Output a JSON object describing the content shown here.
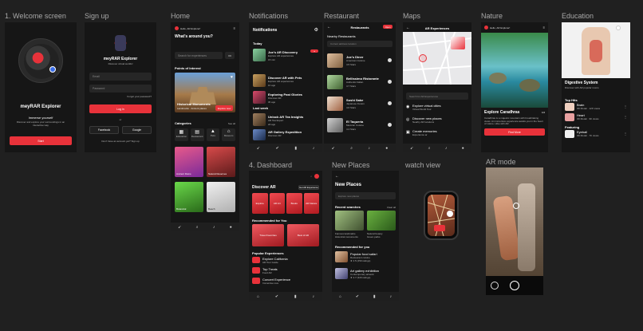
{
  "frames": {
    "welcome": "1. Welcome screen",
    "signup": "Sign up",
    "home": "Home",
    "notifications": "Notifications",
    "restaurant": "Restaurant",
    "maps": "Maps",
    "nature": "Nature",
    "education": "Education",
    "dashboard": "4. Dashboard",
    "new_places": "New Places",
    "watch": "watch view",
    "ar_mode": "AR mode"
  },
  "welcome": {
    "title": "meyRAR Explorer",
    "subtitle": "Immerse yourself",
    "desc": "Discover and explore your surroundings in an interactive way",
    "start": "Start"
  },
  "signup": {
    "title": "meyRAR Explorer",
    "subtitle": "Discover virtual worlds!",
    "email": "Email",
    "password": "Password",
    "forgot": "Forgot your password?",
    "login": "Log in",
    "or": "or",
    "facebook": "Facebook",
    "google": "Google",
    "no_account": "Don't have an account yet? Sign up"
  },
  "home": {
    "hello": "Hello, AR Explorer!",
    "question": "What's around you?",
    "search_placeholder": "Search for experiences",
    "poi": "Points of Interest",
    "poi_card": "Historical Monuments",
    "poi_sub": "Landmarks · Ancient places",
    "explore": "Explore now",
    "categories": "Categories",
    "see_all": "See all",
    "cat": [
      "Education",
      "Restaurant",
      "Pets",
      "Museum"
    ],
    "tiles": [
      "Ancient Ruins",
      "Natural Reserves",
      "Botanical",
      "Beach"
    ]
  },
  "notifications": {
    "title": "Notifications",
    "today": "Today",
    "last_week": "Last week",
    "items": [
      {
        "title": "Joe's AR Discovery",
        "sub": "Explore AR experiences",
        "meta": "15 min"
      },
      {
        "title": "Discover AR with Pets",
        "sub": "Explore AR experiences",
        "meta": "1h ago"
      },
      {
        "title": "Exploring Past Glories",
        "sub": "Discover AR",
        "meta": "3h ago"
      },
      {
        "title": "Unlock AR Tea Insights",
        "sub": "AR Tea Expert",
        "meta": "2d ago"
      },
      {
        "title": "AR Gallery Expedition",
        "sub": "Discover AR",
        "meta": "5d ago"
      }
    ]
  },
  "restaurant": {
    "title": "Restaurants",
    "badge": "Open",
    "nearby": "Nearby Restaurants",
    "address": "Current address location",
    "items": [
      {
        "name": "Joe's Diner",
        "cuisine": "American Cuisine",
        "rating": "4.5 Stars"
      },
      {
        "name": "Bellissimo Ristorante",
        "cuisine": "Authentic Italian",
        "rating": "4.7 Stars"
      },
      {
        "name": "Sushi Sake",
        "cuisine": "Japanese Fusion",
        "rating": "4.6 Stars"
      },
      {
        "name": "El Taqueria",
        "cuisine": "Mexican Cuisine",
        "rating": "4.4 Stars"
      }
    ]
  },
  "maps": {
    "title": "AR Experiences",
    "search_placeholder": "Search for AR Experiences",
    "items": [
      {
        "title": "Explore virtual cities",
        "sub": "Virtual World Tour"
      },
      {
        "title": "Discover new places",
        "sub": "Nearby AR locations"
      },
      {
        "title": "Create memories",
        "sub": "Experience ar"
      }
    ]
  },
  "nature": {
    "hello": "Hello, AR Explorer!",
    "title": "Explore Caradhras",
    "rating": "4.6",
    "desc": "Caradhras is a majestic mountain with breathtaking views. An immersive experience awaits you in the heart of nature. Hike with AR.",
    "button": "Find More"
  },
  "education": {
    "title": "Digestive System",
    "sub": "Discover with AR popular rooms",
    "top_hits": "Top Hits",
    "featuring": "Featuring",
    "items": [
      {
        "title": "Brain",
        "sub": "3D Model · 12K views"
      },
      {
        "title": "Heart",
        "sub": "3D Model · 9K views"
      },
      {
        "title": "Eyeball",
        "sub": "3D Model · 7K views"
      }
    ]
  },
  "dashboard": {
    "discover": "Discover AR",
    "tag": "Get AR Experience",
    "tiles": [
      "Explore",
      "AR Art",
      "Books",
      "AR Nature"
    ],
    "recommended": "Recommended for You",
    "rec": [
      "Travel Favorites",
      "Best of AR"
    ],
    "popular": "Popular Experiences",
    "pop": [
      {
        "title": "Explore California",
        "sub": "AR Tour Guide"
      },
      {
        "title": "Top Treats",
        "sub": "Food AR"
      },
      {
        "title": "Concert Experience",
        "sub": "Immersive Live"
      }
    ]
  },
  "new_places": {
    "title": "New Places",
    "search_placeholder": "Explore new places",
    "recent": "Recent searches",
    "clear": "Clear all",
    "recent_items": [
      {
        "title": "Famous landmarks",
        "sub": "Historical monuments"
      },
      {
        "title": "Natural beauty",
        "sub": "Green parks"
      }
    ],
    "rec_title": "Recommended for you",
    "rec": [
      {
        "title": "Popular food safari",
        "sub": "Restaurant cuisine",
        "meta": "★ 4.5 (450 ratings)"
      },
      {
        "title": "Art gallery exhibition",
        "sub": "Contemporary artwork",
        "meta": "★ 4.7 (320 ratings)"
      }
    ]
  },
  "colors": {
    "accent": "#e8323a",
    "bg": "#202020",
    "screen": "#161616"
  }
}
